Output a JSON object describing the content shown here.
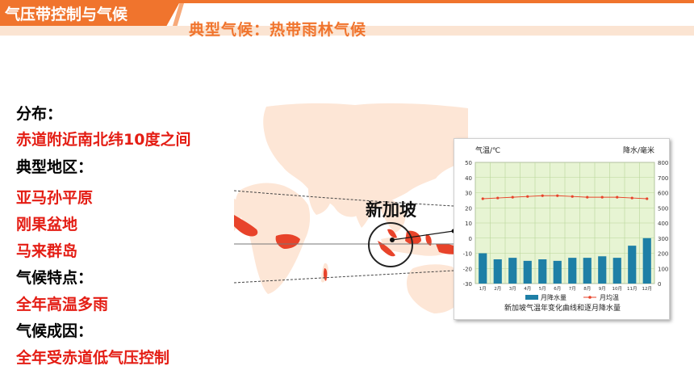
{
  "banner": {
    "title": "气压带控制与气候",
    "subtitle": "典型气候：热带雨林气候"
  },
  "colors": {
    "accent": "#f0742d",
    "text_red": "#e41d14",
    "land": "#fde6d6",
    "rainforest": "#e8432a",
    "chart_bg": "#e7f4d3",
    "bar": "#1e7fa6",
    "line": "#e8432a"
  },
  "info": {
    "distribution_heading": "分布：",
    "distribution_value": "赤道附近南北纬10度之间",
    "regions_heading": "典型地区：",
    "regions": [
      "亚马孙平原",
      "刚果盆地",
      "马来群岛"
    ],
    "features_heading": "气候特点：",
    "features_value": "全年高温多雨",
    "cause_heading": "气候成因：",
    "cause_value": "全年受赤道低气压控制"
  },
  "map": {
    "city_label": "新加坡"
  },
  "chart_data": {
    "type": "bar",
    "title": "新加坡气温年变化曲线和逐月降水量",
    "categories": [
      "1月",
      "2月",
      "3月",
      "4月",
      "5月",
      "6月",
      "7月",
      "8月",
      "9月",
      "10月",
      "11月",
      "12月"
    ],
    "left_axis_label": "气温/℃",
    "right_axis_label": "降水/毫米",
    "temp_ylim": [
      -30,
      50
    ],
    "temp_ticks": [
      -30,
      -20,
      -10,
      0,
      10,
      20,
      30,
      40,
      50
    ],
    "precip_ylim": [
      0,
      800
    ],
    "precip_ticks": [
      0,
      100,
      200,
      300,
      400,
      500,
      600,
      700,
      800
    ],
    "series": [
      {
        "name": "月降水量",
        "type": "bar",
        "axis": "right",
        "values": [
          200,
          160,
          170,
          150,
          160,
          150,
          170,
          170,
          180,
          170,
          250,
          300
        ]
      },
      {
        "name": "月均温",
        "type": "line",
        "axis": "left",
        "values": [
          26,
          26.5,
          27,
          27.5,
          28,
          28,
          27.5,
          27,
          27,
          27,
          26.5,
          26
        ]
      }
    ],
    "grid": true,
    "legend": "bottom"
  }
}
